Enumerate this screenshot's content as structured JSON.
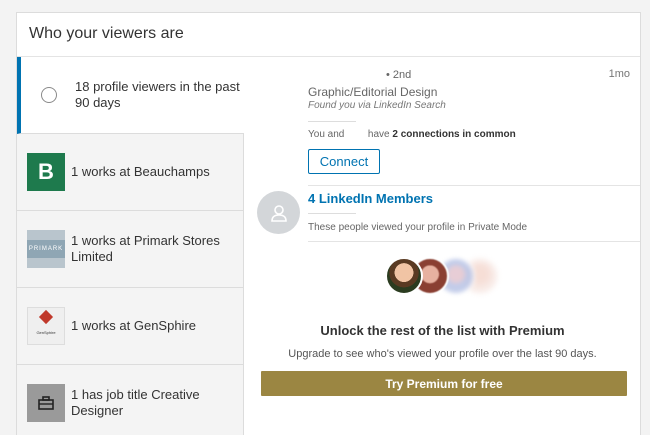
{
  "header": {
    "title": "Who your viewers are"
  },
  "sidebar": {
    "items": [
      {
        "label": "18 profile viewers in the past 90 days",
        "icon": "radio-icon",
        "active": true
      },
      {
        "label": "1 works at Beauchamps",
        "icon": "beauchamps-logo",
        "logo_text": "B"
      },
      {
        "label": "1 works at Primark Stores Limited",
        "icon": "primark-logo",
        "logo_text": "PRIMARK"
      },
      {
        "label": "1 works at GenSphire",
        "icon": "gensphire-logo",
        "logo_text": "GenSphire"
      },
      {
        "label": "1 has job title Creative Designer",
        "icon": "briefcase-icon"
      }
    ]
  },
  "viewer": {
    "degree": "• 2nd",
    "time": "1mo",
    "headline": "Graphic/Editorial Design",
    "found_via": "Found you via LinkedIn Search",
    "connections_prefix": "You and",
    "connections_mid": "have",
    "connections_bold": "2 connections in common",
    "connect_label": "Connect"
  },
  "private": {
    "title": "4 LinkedIn Members",
    "text": "These people viewed your profile in Private Mode"
  },
  "premium": {
    "title": "Unlock the rest of the list with Premium",
    "subtitle": "Upgrade to see who's viewed your profile over the last 90 days.",
    "button_label": "Try Premium for free"
  },
  "colors": {
    "accent": "#0073b1",
    "premium_gold": "#9b8642",
    "beauchamps_green": "#1e7a4d"
  }
}
